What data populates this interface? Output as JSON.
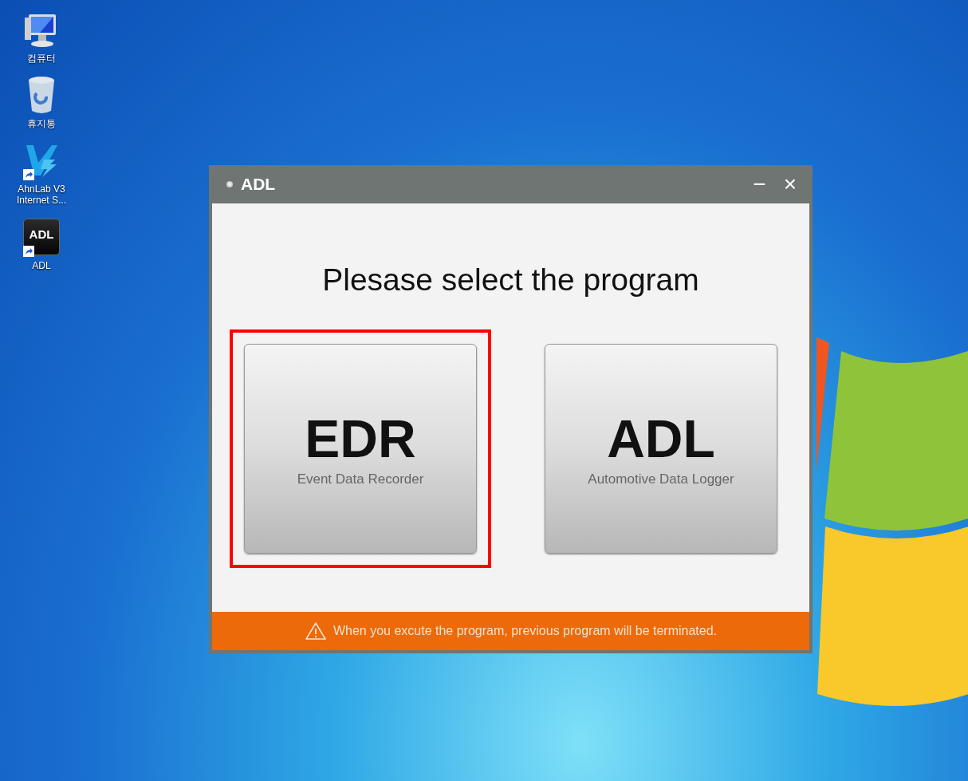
{
  "desktop_icons": [
    {
      "kind": "computer",
      "label": "컴퓨터",
      "shortcut": false
    },
    {
      "kind": "recycle",
      "label": "휴지통",
      "shortcut": false
    },
    {
      "kind": "v3",
      "label": "AhnLab V3 Internet S...",
      "shortcut": true
    },
    {
      "kind": "app",
      "label": "ADL",
      "icon_text": "ADL",
      "shortcut": true
    }
  ],
  "window": {
    "title": "ADL",
    "minimize": "−",
    "close": "×",
    "heading": "Plesase select the program",
    "programs": [
      {
        "code": "EDR",
        "name": "Event Data Recorder",
        "highlighted": true
      },
      {
        "code": "ADL",
        "name": "Automotive Data Logger",
        "highlighted": false
      }
    ],
    "warning": "When you excute the program, previous program will be terminated."
  }
}
